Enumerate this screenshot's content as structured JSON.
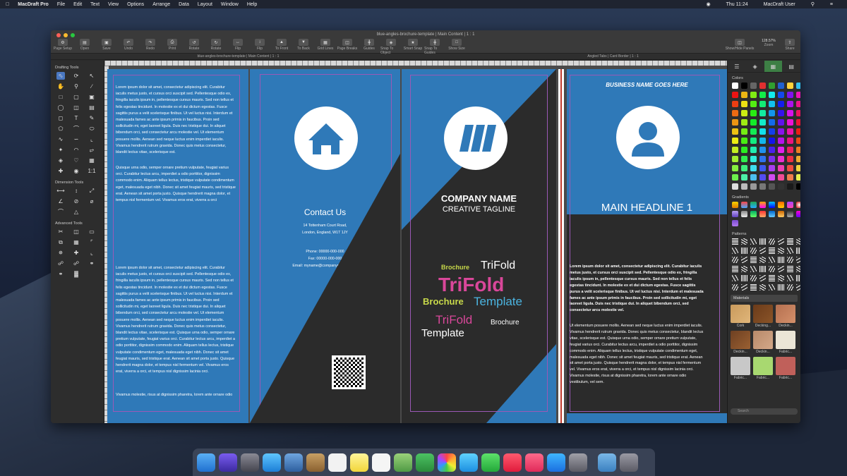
{
  "menubar": {
    "app_name": "MacDraft Pro",
    "items": [
      "File",
      "Edit",
      "Text",
      "View",
      "Options",
      "Arrange",
      "Data",
      "Layout",
      "Window",
      "Help"
    ],
    "time": "Thu 11:24",
    "user": "MacDraft User"
  },
  "window": {
    "title": "blue-angles-brochure-template | Main Content | 1 : 1",
    "tab_left": "blue-angles-brochure-template | Main Content | 1 : 1",
    "tab_right": "Angled Tabs | Card Border | 1 : 1",
    "zoom": "128.57%",
    "toolbar": [
      "Page Setup",
      "Open",
      "Save",
      "Undo",
      "Redo",
      "Print",
      "Rotate",
      "Rotate",
      "Flip",
      "Flip",
      "To Front",
      "To Back",
      "Grid Lines",
      "Page Breaks",
      "Guides",
      "Snap To Object",
      "Smart Snap",
      "Snap To Guides",
      "Show Size"
    ],
    "toolbar_right": [
      "Show/Hide Panels",
      "Zoom",
      "Share"
    ]
  },
  "palette": {
    "drafting_title": "Drafting Tools",
    "dimension_title": "Dimension Tools",
    "advanced_title": "Advanced Tools"
  },
  "brochure": {
    "body_text_1": "Lorem ipsum dolor sit amet, consectetur adipiscing elit. Curabitur iaculis metus justo, et cursus orci suscipit sed. Pellentesque odio ex, fringilla iaculis ipsum in, pellentesque cursus mauris. Sed non tellus et felis egestas tincidunt. In molestie ex et dui dictum egestas. Fusce sagittis purus a velit scelerisque finibus. Ut vel luctus nisi. Interdum et malesuada fames ac ante ipsum primis in faucibus. Proin sed sollicitudin mi, eget laoreet ligula. Duis nec tristique dui. In aliquet bibendum orci, sed consectetur arcu molestie vel. Ut elementum posuere mollis. Aenean sed neque luctus enim imperdiet iaculis. Vivamus hendrerit rutrum gravida. Donec quis metus consectetur, blandit lectus vitae, scelerisque est.",
    "body_text_2": "Quisque urna odio, semper ornare pretium vulputate, feugiat varius orci. Curabitur lectus arcu, imperdiet a odio porttitor, dignissim commodo enim. Aliquam tellus lectus, tristique vulputate condimentum eget, malesuada eget nibh. Donec sit amet feugiat mauris, sed tristique erat. Aenean sit amet porta justo. Quisque hendrerit magna dolor, et tempus nisl fermentum vel. Vivamus eros erat, viverra a orci",
    "body_text_3": "Lorem ipsum dolor sit amet, consectetur adipiscing elit. Curabitur iaculis metus justo, et cursus orci suscipit sed. Pellentesque odio ex, fringilla iaculis ipsum in, pellentesque cursus mauris. Sed non tellus et felis egestas tincidunt. In molestie ex et dui dictum egestas. Fusce sagittis purus a velit scelerisque finibus. Ut vel luctus nisi. Interdum et malesuada fames ac ante ipsum primis in faucibus. Proin sed sollicitudin mi, eget laoreet ligula. Duis nec tristique dui. In aliquet bibendum orci, sed consectetur arcu molestie vel. Ut elementum posuere mollis. Aenean sed neque luctus enim imperdiet iaculis. Vivamus hendrerit rutrum gravida. Donec quis metus consectetur, blandit lectus vitae, scelerisque est. Quisque urna odio, semper ornare pretium vulputate, feugiat varius orci. Curabitur lectus arcu, imperdiet a odio porttitor, dignissim commodo enim. Aliquam tellus lectus, tristique vulputate condimentum eget, malesuada eget nibh. Donec sit amet feugiat mauris, sed tristique erat. Aenean sit amet porta justo. Quisque hendrerit magna dolor, et tempus nisl fermentum vel. Vivamus eros erat, viverra a orci, et tempus nisl dignissim lacinia orci.",
    "body_text_4": "Vivamus molestie, risus at dignissim pharetra, lorem ante ornare odio",
    "contact_title": "Contact Us",
    "address_1": "14 Tottenham Court Road,",
    "address_2": "London, England, W1T 1JY",
    "phone": "Phone: 00000-000-000",
    "fax": "Fax: 00000-000-000",
    "email": "Email: myname@companydomain.com",
    "company_name": "COMPANY NAME",
    "tagline": "CREATIVE TAGLINE",
    "wc_brochure": "Brochure",
    "wc_trifold": "TriFold",
    "wc_template": "Template",
    "business_name": "BUSINESS NAME GOES HERE",
    "headline": "MAIN HEADLINE 1",
    "right_bold": "Lorem ipsum dolor sit amet, consectetur adipiscing elit. Curabitur iaculis metus justo, et cursus orci suscipit sed. Pellentesque odio ex, fringilla iaculis ipsum in, pellentesque cursus mauris. Sed non tellus et felis egestas tincidunt. In molestie ex et dui dictum egestas. Fusce sagittis purus a velit scelerisque finibus. Ut vel luctus nisi. Interdum et malesuada fames ac ante ipsum primis in faucibus. Proin sed sollicitudin mi, eget laoreet ligula. Duis nec tristique dui. In aliquet bibendum orci, sed consectetur arcu molestie vel.",
    "right_text": "Ut elementum posuere mollis. Aenean sed neque luctus enim imperdiet iaculis. Vivamus hendrerit rutrum gravida. Donec quis metus consectetur, blandit lectus vitae, scelerisque est. Quisque urna odio, semper ornare pretium vulputate, feugiat varius orci. Curabitur lectus arcu, imperdiet a odio porttitor, dignissim commodo enim. Aliquam tellus lectus, tristique vulputate condimentum eget, malesuada eget nibh. Donec sit amet feugiat mauris, sed tristique erat. Aenean sit amet porta justo. Quisque hendrerit magna dolor, et tempus nisl fermentum vel. Vivamus eros erat, viverra a orci, et tempus nisl dignissim lacinia orci. Vivamus molestie, risus at dignissim pharetra, lorem ante ornare odio vestibulum, vel sem."
  },
  "inspector": {
    "colors_title": "Colors",
    "gradients_title": "Gradients",
    "patterns_title": "Patterns",
    "materials_select": "Materials",
    "search_placeholder": "Search",
    "materials": [
      "Cork",
      "Decking...",
      "Deckin...",
      "Deckin...",
      "Deckin...",
      "Fabric...",
      "Fabric...",
      "Fabric...",
      "Fabric..."
    ]
  },
  "colors": {
    "brochure_blue": "#2f79b8",
    "brochure_dark": "#2b2b2b",
    "guide_purple": "#9b59b6"
  }
}
